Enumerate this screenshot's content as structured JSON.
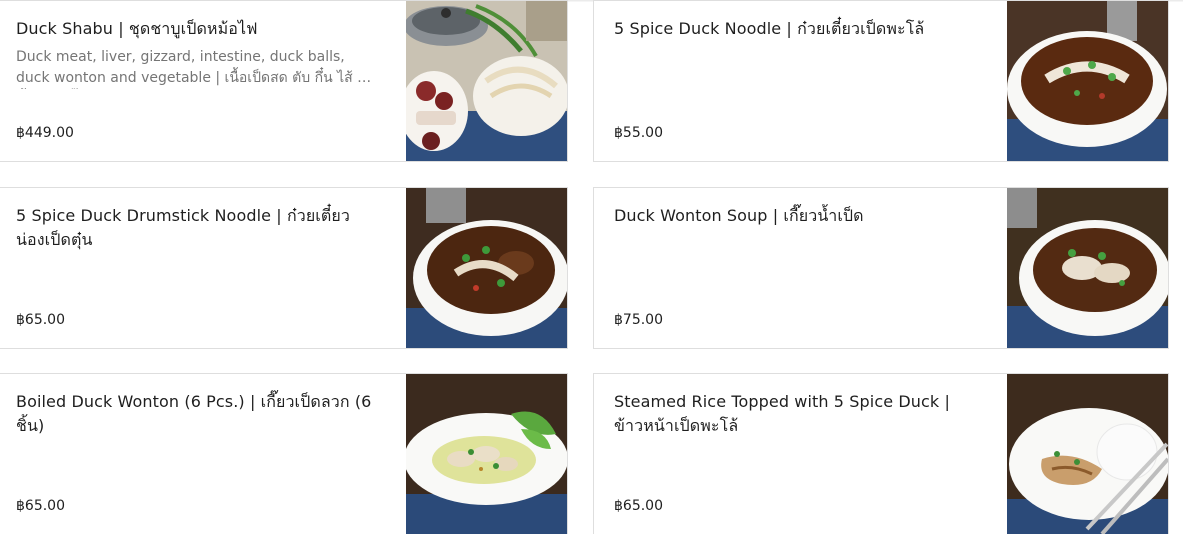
{
  "items": [
    {
      "title": "Duck Shabu | ชุดชาบูเป็ดหม้อไฟ",
      "description": "Duck meat, liver, gizzard, intestine, duck balls, duck wonton and vegetable | เนื้อเป็ดสด ตับ กึ๋น ไส้ ลูกชิ้นเป็ด เกี๊ยวเป็ด และผัก",
      "price": "฿449.00",
      "image": "hotpot-photo"
    },
    {
      "title": "5 Spice Duck Noodle | ก๋วยเตี๋ยวเป็ดพะโล้",
      "description": "",
      "price": "฿55.00",
      "image": "noodle-bowl-photo"
    },
    {
      "title": "5 Spice Duck Drumstick Noodle | ก๋วยเตี๋ยวน่องเป็ดตุ๋น",
      "description": "",
      "price": "฿65.00",
      "image": "drumstick-noodle-photo"
    },
    {
      "title": "Duck Wonton Soup | เกี๊ยวน้ำเป็ด",
      "description": "",
      "price": "฿75.00",
      "image": "wonton-soup-photo"
    },
    {
      "title": "Boiled Duck Wonton (6 Pcs.) | เกี๊ยวเป็ดลวก (6 ชิ้น)",
      "description": "",
      "price": "฿65.00",
      "image": "boiled-wonton-plate-photo"
    },
    {
      "title": "Steamed Rice Topped with 5 Spice Duck | ข้าวหน้าเป็ดพะโล้",
      "description": "",
      "price": "฿65.00",
      "image": "duck-rice-plate-photo"
    }
  ]
}
